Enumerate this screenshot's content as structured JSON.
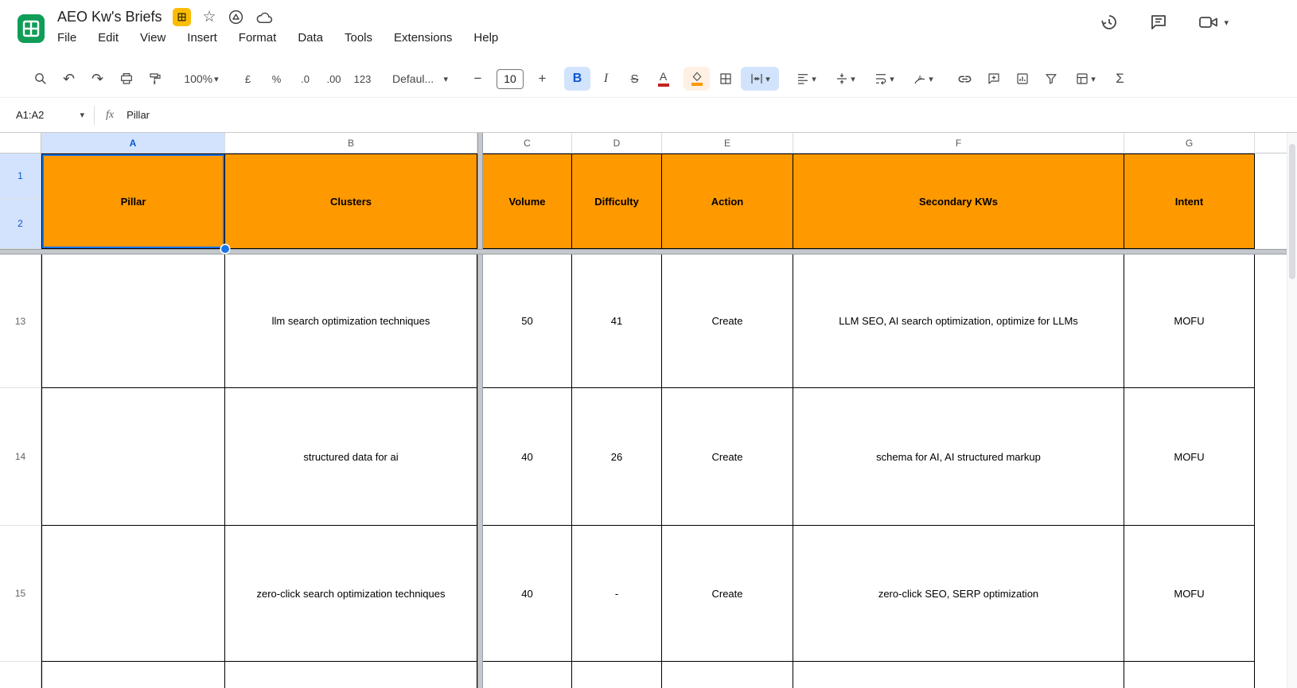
{
  "titlebar": {
    "title": "AEO Kw's Briefs",
    "star": "☆",
    "menus": [
      "File",
      "Edit",
      "View",
      "Insert",
      "Format",
      "Data",
      "Tools",
      "Extensions",
      "Help"
    ]
  },
  "toolbar": {
    "zoom": "100%",
    "currency": "£",
    "percent": "%",
    "decrease_decimal": ".0",
    "increase_decimal": ".00",
    "number_format": "123",
    "font_name": "Defaul...",
    "font_size": "10",
    "minus": "−",
    "plus": "+",
    "bold": "B",
    "italic": "I",
    "strikethrough": "S",
    "text_color": "A",
    "sigma": "Σ"
  },
  "ui": {
    "chevron": "▾"
  },
  "formula_bar": {
    "range": "A1:A2",
    "fx": "fx",
    "content": "Pillar"
  },
  "grid": {
    "col_headers": [
      "A",
      "B",
      "C",
      "D",
      "E",
      "F",
      "G"
    ],
    "header_row": {
      "row_numbers": [
        "1",
        "2"
      ],
      "cells": [
        "Pillar",
        "Clusters",
        "Volume",
        "Difficulty",
        "Action",
        "Secondary KWs",
        "Intent"
      ]
    },
    "rows": [
      {
        "num": "13",
        "cells": [
          "",
          "llm search optimization techniques",
          "50",
          "41",
          "Create",
          "LLM SEO, AI search optimization, optimize for LLMs",
          "MOFU"
        ]
      },
      {
        "num": "14",
        "cells": [
          "",
          "structured data for ai",
          "40",
          "26",
          "Create",
          "schema for AI, AI structured markup",
          "MOFU"
        ]
      },
      {
        "num": "15",
        "cells": [
          "",
          "zero-click search optimization techniques",
          "40",
          "-",
          "Create",
          "zero-click SEO, SERP optimization",
          "MOFU"
        ]
      }
    ]
  },
  "colors": {
    "header_fill": "#ff9900",
    "selection_blue": "#1a73e8",
    "selected_header_bg": "#d3e3fd",
    "selected_header_text": "#0b57d0",
    "text_color_indicator": "#c5221f",
    "fill_color_indicator": "#ff9900",
    "badge_yellow": "#fbbc04",
    "active_pill": "#d2e3fc"
  }
}
